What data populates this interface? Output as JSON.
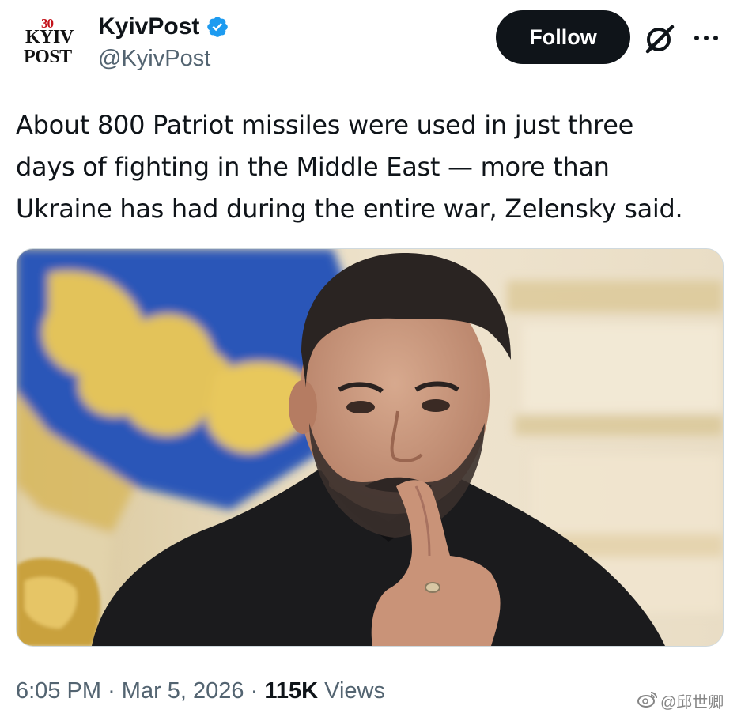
{
  "account": {
    "display_name": "KyivPost",
    "handle": "@KyivPost",
    "logo_text": {
      "number": "30",
      "line1": "KYIV",
      "line2": "POST"
    },
    "verified_icon": "verified-badge-icon",
    "verified_color": "#1d9bf0"
  },
  "actions": {
    "follow_label": "Follow",
    "grok_icon": "grok-icon",
    "more_icon": "more-options-icon"
  },
  "tweet": {
    "text": "About 800 Patriot missiles were used in just three\ndays of fighting in the Middle East — more than\nUkraine has had during the entire war, Zelensky said.",
    "media_alt": "Photo of Zelensky in a black shirt, finger raised to his lips, in front of a blue and yellow flag"
  },
  "meta": {
    "time": "6:05 PM",
    "separator": "·",
    "date": "Mar 5, 2026",
    "views_count": "115K",
    "views_label": "Views"
  },
  "watermark": {
    "text": "@邱世卿"
  },
  "colors": {
    "text_primary": "#0f1419",
    "text_secondary": "#536471",
    "follow_bg": "#0f1419",
    "follow_fg": "#ffffff",
    "logo_red": "#c4121a"
  }
}
